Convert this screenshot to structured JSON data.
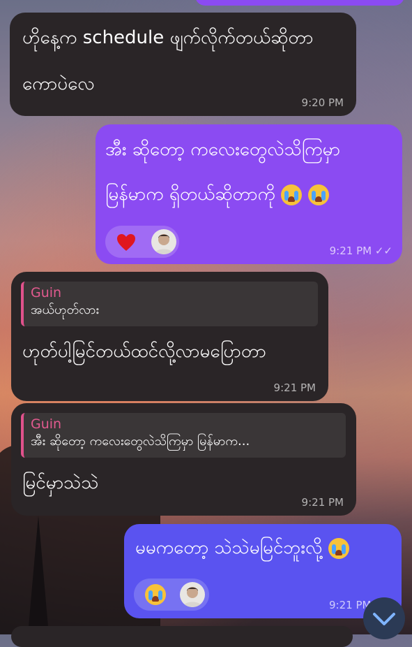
{
  "messages": [
    {
      "id": "m1",
      "direction": "incoming",
      "lines": [
        "ဟိုနေ့က schedule ဖျက်လိုက်တယ်ဆိုတာ",
        "ကောပဲလေ"
      ],
      "time": "9:20 PM"
    },
    {
      "id": "m2",
      "direction": "outgoing",
      "lines": [
        "အီး ဆိုတော့ ကလေးတွေလဲသိကြမှာ",
        "မြန်မာက ရှိတယ်ဆိုတာကို"
      ],
      "time": "9:21 PM",
      "reactions": [
        "heart-icon",
        "avatar"
      ],
      "read": true
    },
    {
      "id": "m3",
      "direction": "incoming",
      "reply_name": "Guin",
      "reply_text": "အယ်ဟုတ်လား",
      "lines": [
        "ဟုတ်ပါ့မြင်တယ်ထင်လို့လာမပြောတာ"
      ],
      "time": "9:21 PM"
    },
    {
      "id": "m4",
      "direction": "incoming",
      "reply_name": "Guin",
      "reply_text": "အီး ဆိုတော့ ကလေးတွေလဲသိကြမှာ မြန်မာက...",
      "lines": [
        "မြင်မှာသဲသဲ"
      ],
      "time": "9:21 PM"
    },
    {
      "id": "m5",
      "direction": "outgoing",
      "lines": [
        "မမကတော့ သဲသဲမမြင်ဘူးလို့"
      ],
      "time": "9:21 PM",
      "reactions": [
        "crying-emoji",
        "avatar"
      ]
    }
  ],
  "colors": {
    "incoming": "#2a2527",
    "outgoing": "#8b4bf2",
    "outgoing_alt": "#5a53f0",
    "reply_accent": "#e25a8f"
  },
  "scroll_button_icon": "chevron-down-icon"
}
